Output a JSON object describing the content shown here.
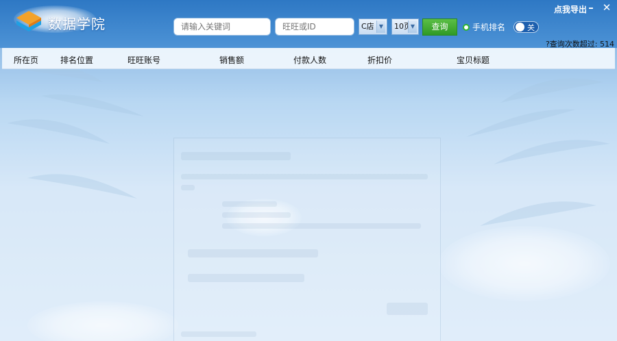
{
  "app": {
    "title": "数据学院"
  },
  "window_controls": {
    "export_label": "点我导出",
    "minimize_glyph": "–",
    "close_glyph": "✕"
  },
  "search": {
    "keyword_placeholder": "请输入关键词",
    "wangwang_placeholder": "旺旺或ID",
    "shop_type": "C店",
    "pages": "10页",
    "query_label": "查询",
    "mobile_rank_label": "手机排名",
    "toggle_label": "关"
  },
  "status": {
    "query_count": "?查询次数超过: 514"
  },
  "table": {
    "columns": [
      "所在页",
      "排名位置",
      "旺旺账号",
      "销售额",
      "付款人数",
      "折扣价",
      "宝贝标题"
    ],
    "rows": []
  },
  "colors": {
    "accent_green": "#2f9a25",
    "sky_blue": "#2e78c4"
  }
}
